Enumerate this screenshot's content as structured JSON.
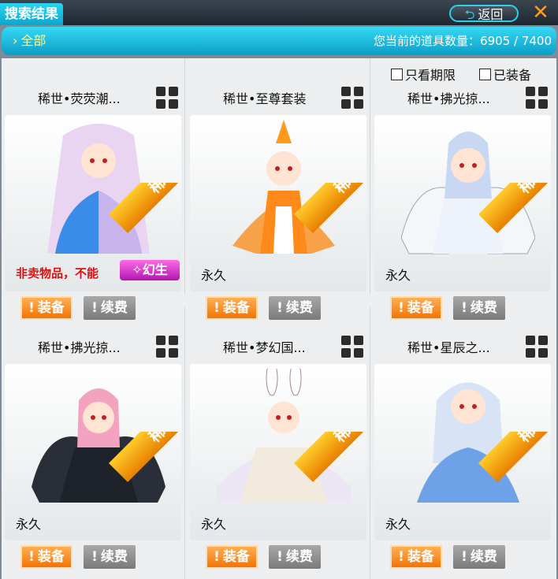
{
  "window": {
    "title": "搜索结果",
    "back_label": "返回",
    "back_icon": "return-arrow",
    "close_icon": "close-x",
    "accent": "#13b8df"
  },
  "filter": {
    "all_label": "全部",
    "count_label": "您当前的道具数量：",
    "count_value": "6905 / 7400"
  },
  "checkboxes": {
    "only_limited": "只看期限",
    "equipped": "已装备"
  },
  "items": [
    {
      "name": "稀世•荧荧潮...",
      "status": "非卖物品，不能",
      "badge": "稀世",
      "reborn": "幻生",
      "equip": "装备",
      "renew": "续费"
    },
    {
      "name": "稀世•至尊套装",
      "status": "永久",
      "badge": "稀世",
      "equip": "装备",
      "renew": "续费"
    },
    {
      "name": "稀世•拂光掠...",
      "status": "永久",
      "badge": "稀世",
      "equip": "装备",
      "renew": "续费"
    },
    {
      "name": "稀世•拂光掠...",
      "status": "永久",
      "badge": "稀世",
      "equip": "装备",
      "renew": "续费"
    },
    {
      "name": "稀世•梦幻国...",
      "status": "永久",
      "badge": "稀世",
      "equip": "装备",
      "renew": "续费"
    },
    {
      "name": "稀世•星辰之...",
      "status": "永久",
      "badge": "稀世",
      "equip": "装备",
      "renew": "续费"
    }
  ]
}
